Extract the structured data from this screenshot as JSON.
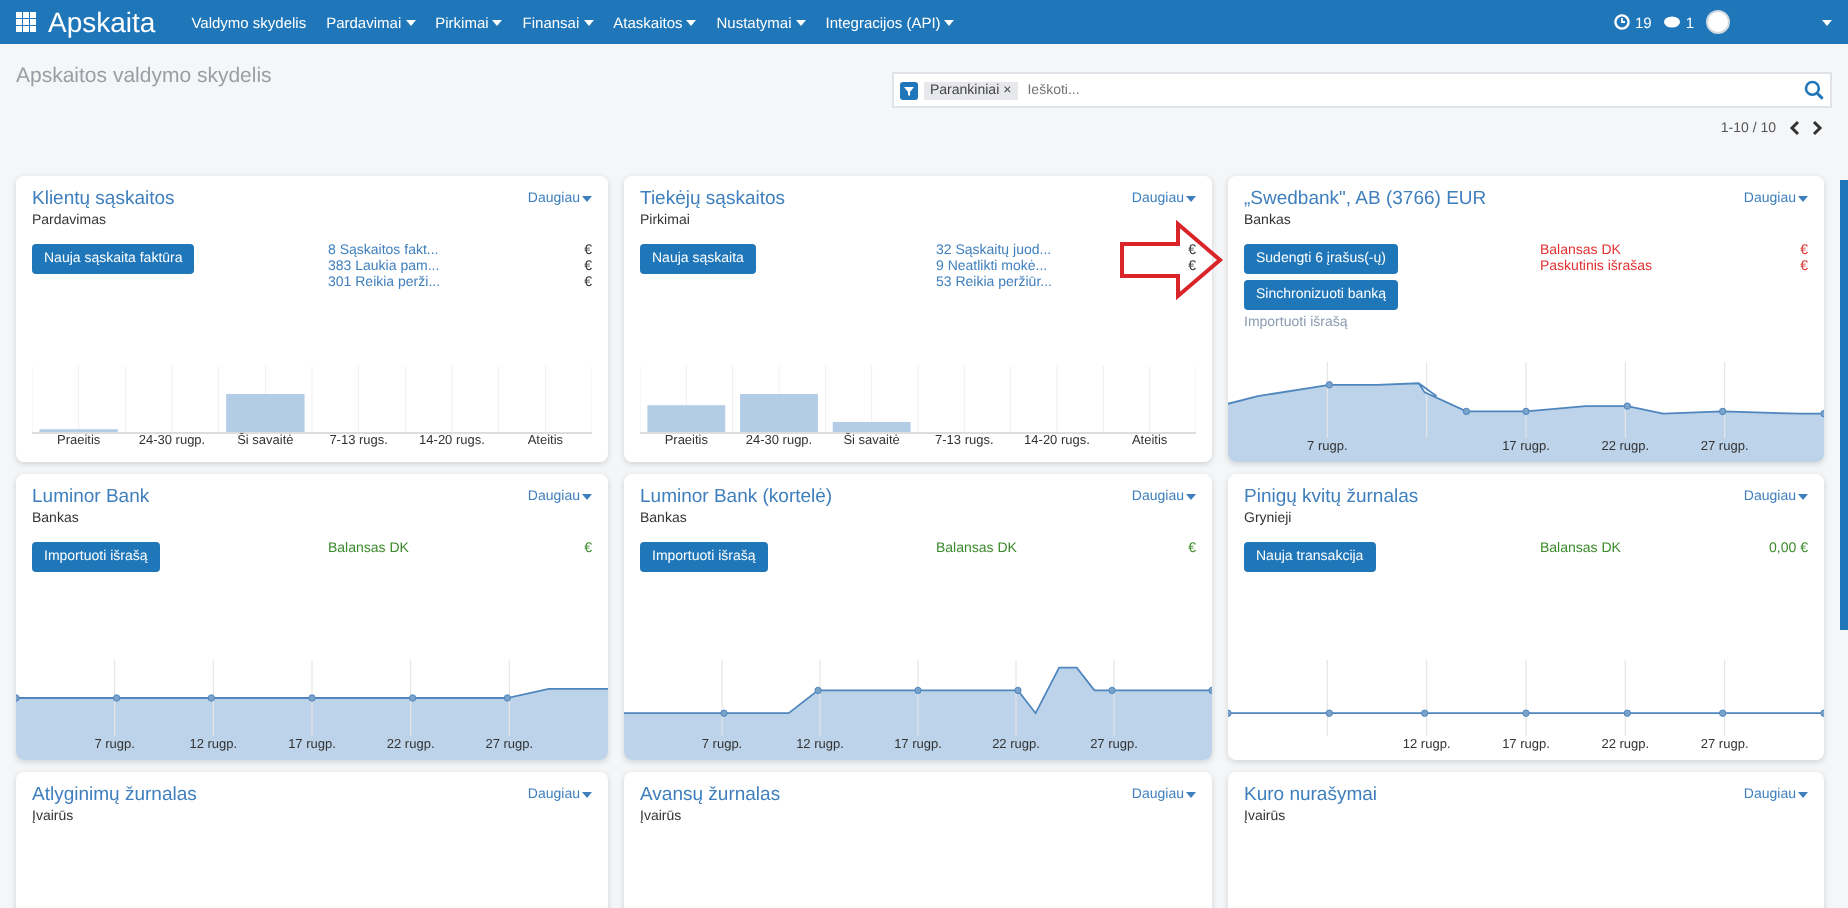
{
  "navbar": {
    "app_title": "Apskaita",
    "menu": [
      {
        "label": "Valdymo skydelis",
        "dropdown": false
      },
      {
        "label": "Pardavimai",
        "dropdown": true
      },
      {
        "label": "Pirkimai",
        "dropdown": true
      },
      {
        "label": "Finansai",
        "dropdown": true
      },
      {
        "label": "Ataskaitos",
        "dropdown": true
      },
      {
        "label": "Nustatymai",
        "dropdown": true
      },
      {
        "label": "Integracijos (API)",
        "dropdown": true
      }
    ],
    "activities_count": "19",
    "messages_count": "1"
  },
  "breadcrumb": "Apskaitos valdymo skydelis",
  "search": {
    "facet": "Parankiniai",
    "facet_remove": "×",
    "placeholder": "Ieškoti..."
  },
  "pager": {
    "range": "1-10 / 10"
  },
  "cards": [
    {
      "title": "Klientų sąskaitos",
      "subtitle": "Pardavimas",
      "more": "Daugiau",
      "buttons": [
        "Nauja sąskaita faktūra"
      ],
      "stats": [
        {
          "label": "8 Sąskaitos fakt...",
          "value": "€",
          "color": "#3f7fbd"
        },
        {
          "label": "383 Laukia pam...",
          "value": "€",
          "color": "#3f7fbd"
        },
        {
          "label": "301 Reikia perži...",
          "value": "€",
          "color": "#3f7fbd"
        }
      ],
      "kind": "bars",
      "x_labels": [
        "Praeitis",
        "24-30 rugp.",
        "Ši savaitė",
        "7-13 rugs.",
        "14-20 rugs.",
        "Ateitis"
      ]
    },
    {
      "title": "Tiekėjų sąskaitos",
      "subtitle": "Pirkimai",
      "more": "Daugiau",
      "buttons": [
        "Nauja sąskaita"
      ],
      "stats": [
        {
          "label": "32 Sąskaitų juod...",
          "value": "€",
          "color": "#3f7fbd"
        },
        {
          "label": "9 Neatlikti mokė...",
          "value": "€",
          "color": "#3f7fbd"
        },
        {
          "label": "53 Reikia peržiūr...",
          "color": "#3f7fbd"
        }
      ],
      "kind": "bars",
      "x_labels": [
        "Praeitis",
        "24-30 rugp.",
        "Ši savaitė",
        "7-13 rugs.",
        "14-20 rugs.",
        "Ateitis"
      ]
    },
    {
      "title": "„Swedbank\", AB (3766) EUR",
      "subtitle": "Bankas",
      "more": "Daugiau",
      "buttons": [
        "Sudengti 6 įrašus(-ų)",
        "Sinchronizuoti banką"
      ],
      "link": "Importuoti išrašą",
      "stats": [
        {
          "label": "Balansas DK",
          "value": "€",
          "color": "#e03030"
        },
        {
          "label": "Paskutinis išrašas",
          "value": "€",
          "color": "#e03030"
        }
      ],
      "kind": "line",
      "x_labels": [
        "7 rugp.",
        "17 rugp.",
        "22 rugp.",
        "27 rugp."
      ]
    },
    {
      "title": "Luminor Bank",
      "subtitle": "Bankas",
      "more": "Daugiau",
      "buttons": [
        "Importuoti išrašą"
      ],
      "stats": [
        {
          "label": "Balansas DK",
          "value": "€",
          "color": "#3a8a2a"
        }
      ],
      "kind": "line",
      "x_labels": [
        "7 rugp.",
        "12 rugp.",
        "17 rugp.",
        "22 rugp.",
        "27 rugp."
      ]
    },
    {
      "title": "Luminor Bank (kortelė)",
      "subtitle": "Bankas",
      "more": "Daugiau",
      "buttons": [
        "Importuoti išrašą"
      ],
      "stats": [
        {
          "label": "Balansas DK",
          "value": "€",
          "color": "#3a8a2a"
        }
      ],
      "kind": "line",
      "x_labels": [
        "7 rugp.",
        "12 rugp.",
        "17 rugp.",
        "22 rugp.",
        "27 rugp."
      ]
    },
    {
      "title": "Pinigų kvitų žurnalas",
      "subtitle": "Grynieji",
      "more": "Daugiau",
      "buttons": [
        "Nauja transakcija"
      ],
      "stats": [
        {
          "label": "Balansas DK",
          "value": "0,00 €",
          "color": "#3a8a2a"
        }
      ],
      "kind": "line",
      "x_labels": [
        "12 rugp.",
        "17 rugp.",
        "22 rugp.",
        "27 rugp."
      ]
    },
    {
      "title": "Atlyginimų žurnalas",
      "subtitle": "Įvairūs",
      "more": "Daugiau"
    },
    {
      "title": "Avansų žurnalas",
      "subtitle": "Įvairūs",
      "more": "Daugiau"
    },
    {
      "title": "Kuro nurašymai",
      "subtitle": "Įvairūs",
      "more": "Daugiau"
    }
  ]
}
